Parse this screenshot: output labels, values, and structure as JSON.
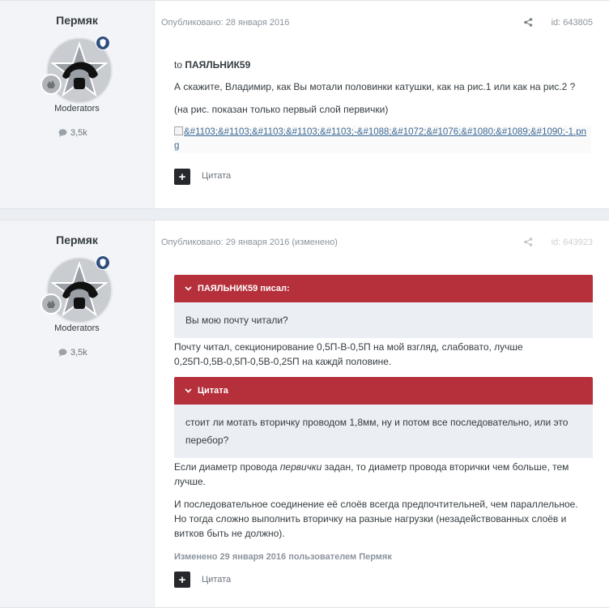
{
  "posts": [
    {
      "author": {
        "name": "Пермяк",
        "group": "Moderators",
        "reputation": "3,5k"
      },
      "meta": "Опубликовано: 28 января 2016",
      "post_id": "id: 643805",
      "body": {
        "greeting_prefix": "to ",
        "greeting_name": "ПАЯЛЬНИК59",
        "line1": "А скажите, Владимир, как Вы мотали половинки катушки, как на рис.1 или как на рис.2 ?",
        "line2": "(на рис. показан только первый слой первички)",
        "image_link": "&#1103;&#1103;&#1103;&#1103;&#1103;-&#1088;&#1072;&#1076;&#1080;&#1089;&#1090;-1.png"
      },
      "cite_label": "Цитата"
    },
    {
      "author": {
        "name": "Пермяк",
        "group": "Moderators",
        "reputation": "3,5k"
      },
      "meta": "Опубликовано: 29 января 2016 (изменено)",
      "post_id": "id: 643923",
      "quote1": {
        "header": "ПАЯЛЬНИК59 писал:",
        "text": "Вы мою почту читали?"
      },
      "reply1": "Почту читал, секционирование 0,5П-В-0,5П на мой взгляд, слабовато, лучше 0,25П-0,5В-0,5П-0,5В-0,25П на каждй половине.",
      "quote2": {
        "header": "Цитата",
        "text": "стоит ли мотать вторичку проводом 1,8мм, ну и потом все последовательно, или это перебор?"
      },
      "reply2_before": "Если диаметр провода ",
      "reply2_em": "первички",
      "reply2_after": " задан, то диаметр провода вторички чем больше, тем лучше.",
      "reply3": "И последовательное соединение её слоёв всегда предпочтительней, чем параллельное. Но тогда сложно выполнить вторичку на разные нагрузки (незадействованных слоёв и витков быть не должно).",
      "edited": "Изменено 29 января 2016 пользователем Пермяк",
      "cite_label": "Цитата"
    }
  ],
  "colors": {
    "quote_header": "#b5303b",
    "quote_body": "#ebeef2",
    "mod_badge": "#2f4f7f"
  }
}
